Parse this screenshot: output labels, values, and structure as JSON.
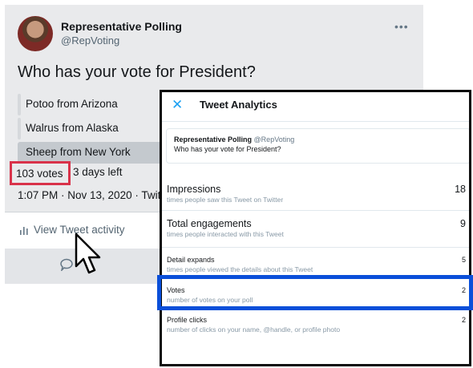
{
  "tweet": {
    "author_name": "Representative Polling",
    "author_handle": "@RepVoting",
    "more_icon": "more-dots-icon",
    "question": "Who has your vote for President?",
    "poll_options": [
      {
        "label": "Potoo from Arizona"
      },
      {
        "label": "Walrus from Alaska"
      },
      {
        "label": "Sheep from New York"
      }
    ],
    "votes_text": "103 votes",
    "time_left": "3 days left",
    "timestamp": "1:07 PM · Nov 13, 2020 · Twitt",
    "view_activity_label": "View Tweet activity",
    "activity_icon": "bar-chart-icon",
    "reply_icon": "reply-icon"
  },
  "analytics": {
    "title": "Tweet Analytics",
    "close_icon": "close-icon",
    "tweet_author": "Representative Polling",
    "tweet_handle": "@RepVoting",
    "tweet_text": "Who has your vote for President?",
    "metrics": [
      {
        "label": "Impressions",
        "desc": "times people saw this Tweet on Twitter",
        "value": "18"
      },
      {
        "label": "Total engagements",
        "desc": "times people interacted with this Tweet",
        "value": "9"
      },
      {
        "label": "Detail expands",
        "desc": "times people viewed the details about this Tweet",
        "value": "5"
      },
      {
        "label": "Votes",
        "desc": "number of votes on your poll",
        "value": "2"
      },
      {
        "label": "Profile clicks",
        "desc": "number of clicks on your name, @handle, or profile photo",
        "value": "2"
      }
    ]
  },
  "colors": {
    "votes_box_border": "#d9324a",
    "votes_highlight_border": "#0a4fd9",
    "accent_blue": "#1da1f2"
  }
}
